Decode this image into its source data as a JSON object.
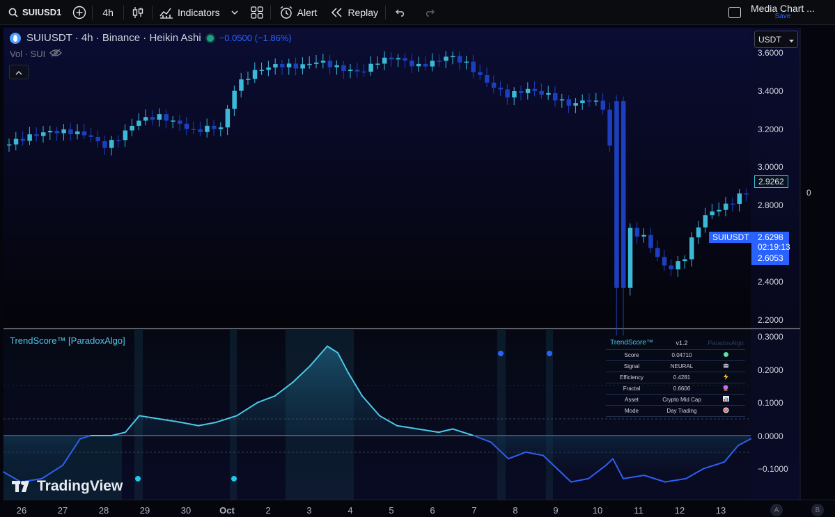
{
  "toolbar": {
    "symbol": "SUIUSD1",
    "interval": "4h",
    "indicators_label": "Indicators",
    "alert_label": "Alert",
    "replay_label": "Replay",
    "layout_name": "Media Chart ...",
    "save_label": "Save"
  },
  "chart": {
    "title": "SUIUSDT · 4h · Binance · Heikin Ashi",
    "change": "−0.0500 (−1.86%)",
    "volume_label": "Vol · SUI",
    "currency": "USDT",
    "price_axis": [
      "3.6000",
      "3.4000",
      "3.2000",
      "3.0000",
      "2.8000",
      "2.4000",
      "2.2000"
    ],
    "current_price": "2.9262",
    "symbol_tag": "SUIUSDT",
    "last_price": "2.6298",
    "countdown": "02:19:13",
    "ha_close": "2.6053",
    "zero_marker": "0"
  },
  "indicator": {
    "title": "TrendScore™ [ParadoxAlgo]",
    "axis": [
      "0.3000",
      "0.2000",
      "0.1000",
      "0.0000",
      "−0.1000"
    ],
    "table": {
      "header": [
        "TrendScore™",
        "v1.2",
        "ParadoxAlgo"
      ],
      "rows": [
        {
          "label": "Score",
          "value": "0.04710",
          "icon": "green-dot"
        },
        {
          "label": "Signal",
          "value": "NEURAL",
          "icon": "robot-icon"
        },
        {
          "label": "Efficiency",
          "value": "0.4281",
          "icon": "lightning-icon"
        },
        {
          "label": "Fractal",
          "value": "0.6606",
          "icon": "crystal-ball-icon"
        },
        {
          "label": "Asset",
          "value": "Crypto Mid Cap",
          "icon": "chart-icon"
        },
        {
          "label": "Mode",
          "value": "Day Trading",
          "icon": "target-icon"
        }
      ]
    }
  },
  "time_axis": [
    "26",
    "27",
    "28",
    "29",
    "30",
    "Oct",
    "2",
    "3",
    "4",
    "5",
    "6",
    "7",
    "8",
    "9",
    "10",
    "11",
    "12",
    "13"
  ],
  "time_axis_buttons": [
    "A",
    "B"
  ],
  "brand": "TradingView",
  "colors": {
    "bull": "#3bb9d6",
    "bear": "#1c3fbf",
    "accent": "#2962ff",
    "osc_line_pos": "#4dc8e8",
    "osc_line_neg": "#2f5ff0"
  },
  "chart_data": {
    "type": "line",
    "series": [
      {
        "name": "SUIUSDT",
        "x": [
          "26",
          "27",
          "28",
          "29",
          "30",
          "Oct",
          "2",
          "3",
          "4",
          "5",
          "6",
          "7",
          "8",
          "9",
          "10",
          "11",
          "12",
          "13"
        ],
        "values": [
          3.15,
          3.22,
          3.18,
          3.27,
          3.25,
          3.35,
          3.55,
          3.57,
          3.55,
          3.58,
          3.62,
          3.55,
          3.45,
          3.4,
          3.4,
          2.75,
          2.55,
          2.93
        ]
      },
      {
        "name": "TrendScore™",
        "x": [
          "26",
          "27",
          "28",
          "29",
          "30",
          "Oct",
          "2",
          "3",
          "4",
          "5",
          "6",
          "7",
          "8",
          "9",
          "10",
          "11",
          "12",
          "13"
        ],
        "values": [
          -0.11,
          -0.03,
          0.0,
          0.06,
          0.04,
          0.06,
          0.12,
          0.22,
          0.25,
          0.07,
          0.03,
          0.0,
          -0.07,
          -0.05,
          -0.13,
          -0.12,
          -0.14,
          -0.02
        ]
      }
    ],
    "ylim": [
      2.2,
      3.65
    ]
  }
}
